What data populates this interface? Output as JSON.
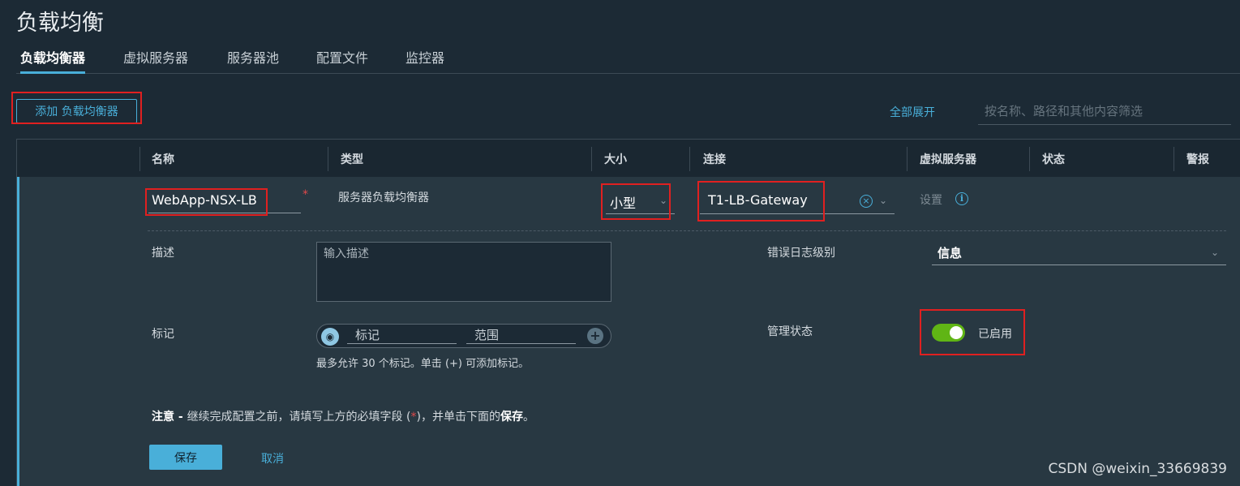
{
  "page": {
    "title": "负载均衡"
  },
  "tabs": [
    {
      "label": "负载均衡器"
    },
    {
      "label": "虚拟服务器"
    },
    {
      "label": "服务器池"
    },
    {
      "label": "配置文件"
    },
    {
      "label": "监控器"
    }
  ],
  "toolbar": {
    "add_label": "添加 负载均衡器",
    "expand_all_label": "全部展开",
    "filter_placeholder": "按名称、路径和其他内容筛选"
  },
  "grid": {
    "columns": [
      "名称",
      "类型",
      "大小",
      "连接",
      "虚拟服务器",
      "状态",
      "警报"
    ]
  },
  "row": {
    "name_value": "WebApp-NSX-LB",
    "required_mark": "*",
    "type": "服务器负载均衡器",
    "size": "小型",
    "connection": "T1-LB-Gateway",
    "virtual_servers": "设置"
  },
  "detail": {
    "description_label": "描述",
    "description_placeholder": "输入描述",
    "error_log_label": "错误日志级别",
    "error_log_value": "信息",
    "tags_label": "标记",
    "tag_placeholder": "标记",
    "scope_placeholder": "范围",
    "tags_hint": "最多允许 30 个标记。单击 (+) 可添加标记。",
    "admin_state_label": "管理状态",
    "admin_state_value": "已启用",
    "admin_state_on": true
  },
  "note": {
    "prefix": "注意 - ",
    "text_before": "继续完成配置之前，请填写上方的必填字段 (",
    "star": "*",
    "text_after": ")，并单击下面的",
    "save_word": "保存",
    "end": "。"
  },
  "actions": {
    "save_label": "保存",
    "cancel_label": "取消"
  },
  "watermark": "CSDN @weixin_33669839",
  "colors": {
    "accent": "#49afd9",
    "toggle_on": "#60b515",
    "highlight": "#e02020",
    "required": "#e0494b",
    "background": "#1c2a35"
  }
}
